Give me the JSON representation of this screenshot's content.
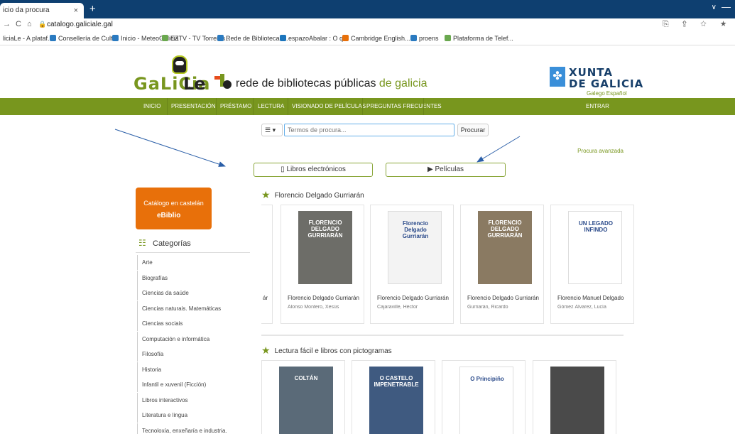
{
  "browser": {
    "tab_title": "icio da procura",
    "tab_close": "×",
    "new_tab": "+",
    "tab_dropdown": "∨",
    "window_minimize": "—",
    "url": "catalogo.galiciale.gal",
    "nav_back": "→",
    "nav_reload": "C",
    "nav_home": "⌂",
    "lock": "🔒",
    "addr_icons": "⎘ ⇪ ☆ ★",
    "bookmarks": [
      {
        "label": "liciaLe - A plataf...",
        "color": "#78961e"
      },
      {
        "label": "Consellería de Cult...",
        "color": "#2a7ac0"
      },
      {
        "label": "Inicio - MeteoGalicia",
        "color": "#2a7ac0"
      },
      {
        "label": "EZTV - TV Torrents...",
        "color": "#6aa84f"
      },
      {
        "label": "Rede de Bibliotecas...",
        "color": "#2a7ac0"
      },
      {
        "label": "espazoAbalar : O q...",
        "color": "#1c75bc"
      },
      {
        "label": "Cambridge English...",
        "color": "#e8700a"
      },
      {
        "label": "proens",
        "color": "#2a7ac0"
      },
      {
        "label": "Plataforma de Telef...",
        "color": "#6aa84f"
      }
    ]
  },
  "header": {
    "logo_galicia": "GaLiCia",
    "logo_le": "Le",
    "rede_prefix": "rede de bibliotecas públicas ",
    "rede_suffix": "de galicia",
    "xunta_line1": "XUNTA",
    "xunta_line2": "DE GALICIA",
    "xunta_emblem": "✤",
    "lang_gl": "Galego",
    "lang_es": "Español"
  },
  "menu": {
    "items": [
      "INICIO",
      "PRESENTACIÓN",
      "PRÉSTAMO",
      "LECTURA",
      "VISIONADO DE PELÍCULAS",
      "PREGUNTAS FRECUENTES"
    ],
    "login": "ENTRAR"
  },
  "search": {
    "view_icon": "☰ ▾",
    "placeholder": "Termos de procura...",
    "button": "Procurar",
    "advanced": "Procura avanzada"
  },
  "quick_buttons": {
    "ebooks": "Libros electrónicos",
    "ebooks_icon": "▯",
    "films": "Películas",
    "films_icon": "▶"
  },
  "sidebar": {
    "castelan_title": "Catálogo en castelán",
    "castelan_brand": "eBiblio",
    "categories_title": "Categorías",
    "categories_icon": "☷",
    "categories": [
      "Arte",
      "Biografías",
      "Ciencias da saúde",
      "Ciencias naturais. Matemáticas",
      "Ciencias sociais",
      "Computación e informática",
      "Filosofía",
      "Historia",
      "Infantil e xuvenil (Ficción)",
      "Libros interactivos",
      "Literatura e lingua",
      "Tecnoloxía, enxeñaría e industria."
    ]
  },
  "sections": [
    {
      "title": "Florencio Delgado Gurriarán",
      "star": "★",
      "partial_text": "ár",
      "books": [
        {
          "title": "Florencio Delgado Gurriarán",
          "author": "Alonso Montero, Xesús",
          "cover_color": "#6d6d68",
          "cover_text": "FLORENCIO DELGADO GURRIARÁN"
        },
        {
          "title": "Florencio Delgado Gurriarán",
          "author": "Cajaraville, Héctor",
          "cover_color": "#f3f3f3",
          "cover_text": "Florencio Delgado Gurriarán"
        },
        {
          "title": "Florencio Delgado Gurriarán",
          "author": "Gurriarán, Ricardo",
          "cover_color": "#8a7a62",
          "cover_text": "FLORENCIO DELGADO GURRIARÁN"
        },
        {
          "title": "Florencio Manuel Delgado",
          "author": "Gómez Álvarez, Lucía",
          "cover_color": "#ffffff",
          "cover_text": "UN LEGADO INFINDO"
        }
      ]
    },
    {
      "title": "Lectura fácil e libros con pictogramas",
      "star": "★",
      "books": [
        {
          "title": "",
          "author": "",
          "cover_color": "#5a6a78",
          "cover_text": "COLTÁN"
        },
        {
          "title": "",
          "author": "",
          "cover_color": "#3f5a80",
          "cover_text": "O CASTELO IMPENETRABLE"
        },
        {
          "title": "",
          "author": "",
          "cover_color": "#ffffff",
          "cover_text": "O Principiño"
        },
        {
          "title": "",
          "author": "",
          "cover_color": "#4a4a4a",
          "cover_text": ""
        }
      ]
    }
  ],
  "colors": {
    "brand_green": "#78961e",
    "orange": "#e8700a",
    "arrow_blue": "#2b5fa8"
  }
}
